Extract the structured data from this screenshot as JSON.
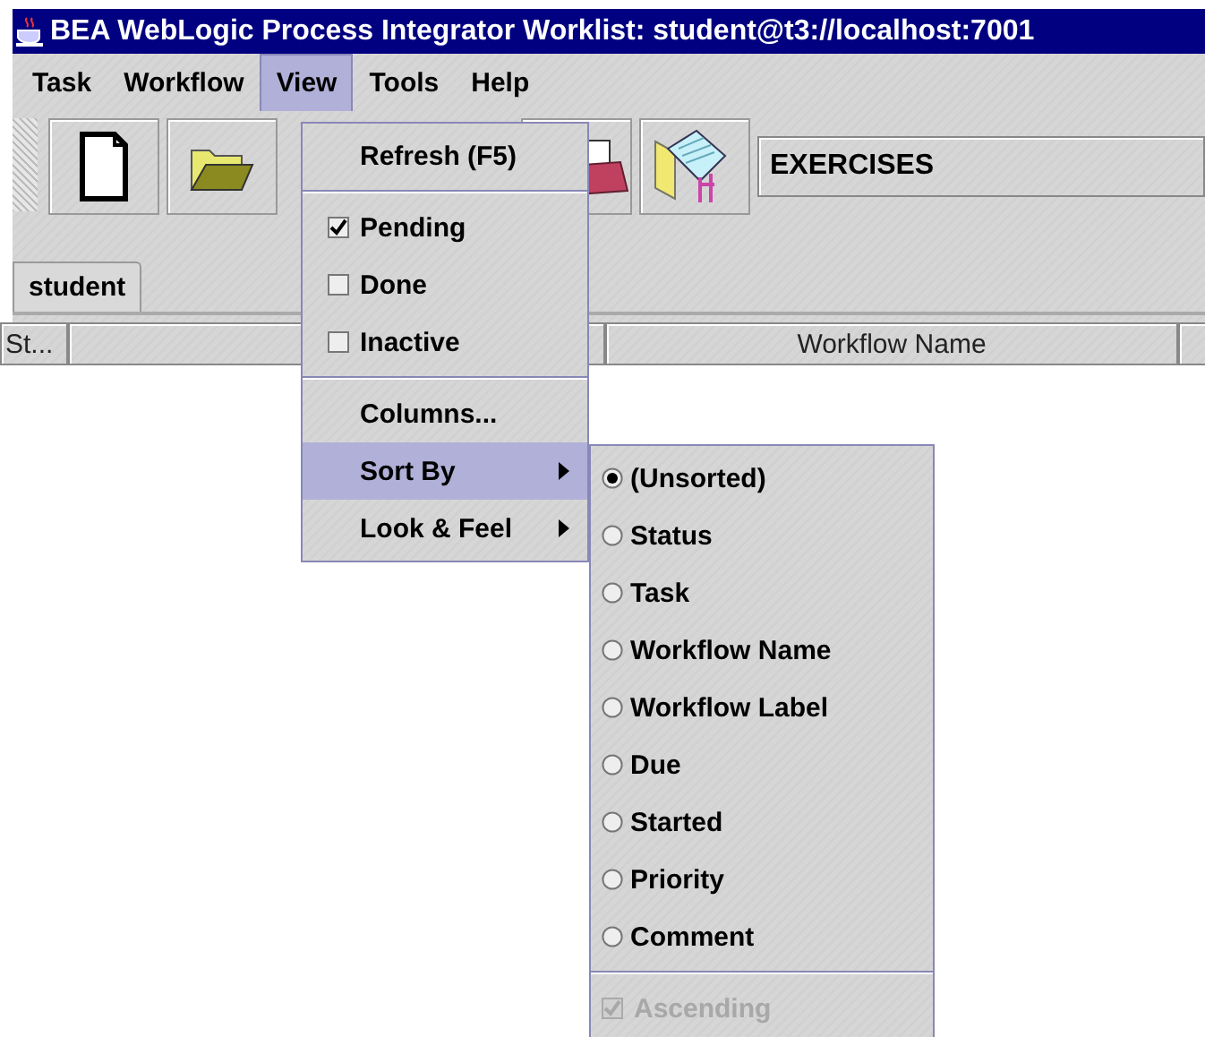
{
  "window": {
    "title": "BEA WebLogic Process Integrator Worklist: student@t3://localhost:7001"
  },
  "menu_bar": [
    {
      "label": "Task",
      "selected": false
    },
    {
      "label": "Workflow",
      "selected": false
    },
    {
      "label": "View",
      "selected": true
    },
    {
      "label": "Tools",
      "selected": false
    },
    {
      "label": "Help",
      "selected": false
    }
  ],
  "toolbar": {
    "buttons": [
      {
        "kind": "new"
      },
      {
        "kind": "open"
      },
      {
        "kind": "hidden"
      },
      {
        "kind": "hidden"
      },
      {
        "kind": "report"
      },
      {
        "kind": "folder"
      }
    ],
    "organization": "EXERCISES"
  },
  "tabs": [
    {
      "label": "student",
      "selected": true
    }
  ],
  "table": {
    "columns": [
      {
        "label": "St..."
      },
      {
        "label": "Workflow Name"
      }
    ]
  },
  "view_menu": {
    "items": [
      {
        "kind": "command",
        "label": "Refresh (F5)"
      },
      {
        "kind": "separator"
      },
      {
        "kind": "check",
        "label": "Pending",
        "checked": true
      },
      {
        "kind": "check",
        "label": "Done",
        "checked": false
      },
      {
        "kind": "check",
        "label": "Inactive",
        "checked": false
      },
      {
        "kind": "separator"
      },
      {
        "kind": "command",
        "label": "Columns..."
      },
      {
        "kind": "submenu",
        "label": "Sort By",
        "selected": true
      },
      {
        "kind": "submenu",
        "label": "Look & Feel",
        "selected": false
      }
    ]
  },
  "sort_menu": {
    "items": [
      {
        "kind": "radio",
        "label": "(Unsorted)",
        "selected": true,
        "disabled": false
      },
      {
        "kind": "radio",
        "label": "Status",
        "selected": false,
        "disabled": false
      },
      {
        "kind": "radio",
        "label": "Task",
        "selected": false,
        "disabled": false
      },
      {
        "kind": "radio",
        "label": "Workflow Name",
        "selected": false,
        "disabled": false
      },
      {
        "kind": "radio",
        "label": "Workflow Label",
        "selected": false,
        "disabled": false
      },
      {
        "kind": "radio",
        "label": "Due",
        "selected": false,
        "disabled": false
      },
      {
        "kind": "radio",
        "label": "Started",
        "selected": false,
        "disabled": false
      },
      {
        "kind": "radio",
        "label": "Priority",
        "selected": false,
        "disabled": false
      },
      {
        "kind": "radio",
        "label": "Comment",
        "selected": false,
        "disabled": false
      },
      {
        "kind": "separator"
      },
      {
        "kind": "check",
        "label": "Ascending",
        "checked": true,
        "disabled": true
      }
    ]
  }
}
